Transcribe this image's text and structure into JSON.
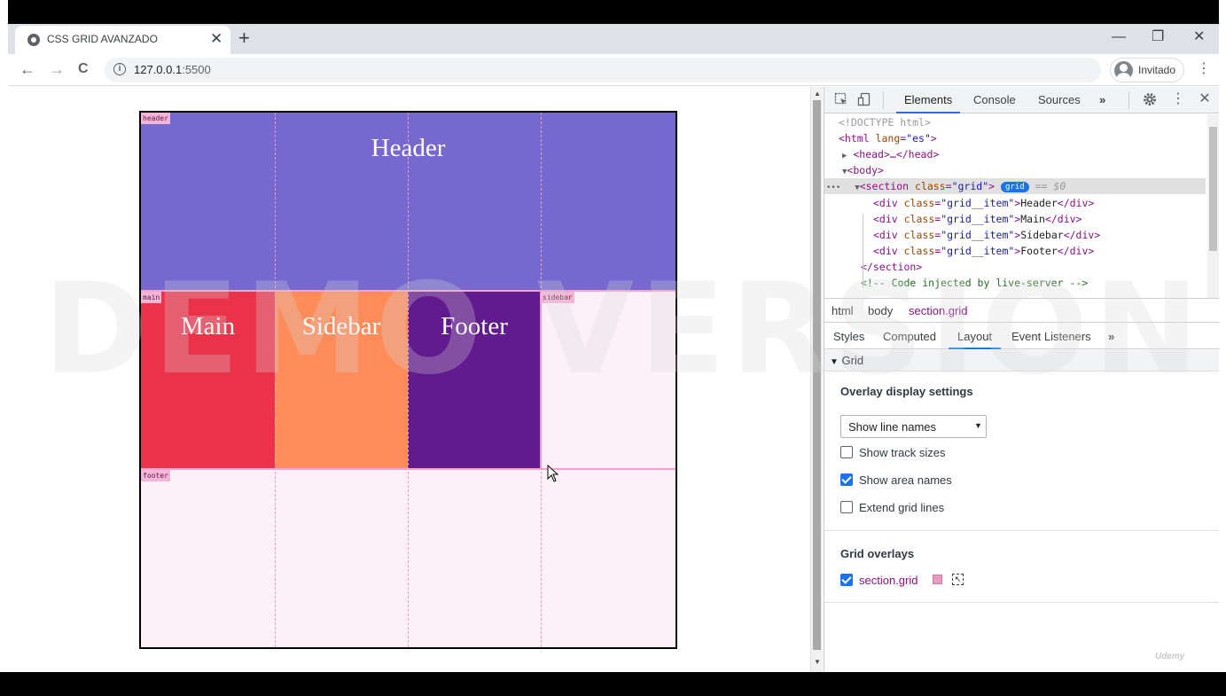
{
  "browser": {
    "tab_title": "CSS GRID AVANZADO",
    "tab_close": "✕",
    "new_tab": "+",
    "minimize": "—",
    "restore": "❐",
    "close": "✕",
    "back": "←",
    "forward": "→",
    "reload": "C",
    "url_host": "127.0.0.1",
    "url_port": ":5500",
    "profile_name": "Invitado",
    "menu": "⋮"
  },
  "page": {
    "cells": {
      "header": "Header",
      "main": "Main",
      "sidebar": "Sidebar",
      "footer": "Footer"
    },
    "area_names": {
      "header": "header",
      "main": "main",
      "sidebar": "sidebar",
      "footer": "footer"
    },
    "watermark": "DEMO VERSION"
  },
  "devtools": {
    "tabs": [
      "Elements",
      "Console",
      "Sources",
      "»"
    ],
    "dom": {
      "doctype": "<!DOCTYPE html>",
      "html_open_tag": "<html",
      "html_attr": "lang",
      "html_val": "\"es\"",
      "head": "<head>…</head>",
      "body": "<body>",
      "section_tag": "<section",
      "section_attr": "class",
      "section_val": "\"grid\"",
      "badge": "grid",
      "eq": "== $0",
      "div_tag": "<div",
      "div_attr": "class",
      "div_val": "\"grid__item\"",
      "div_close": "</div>",
      "items": [
        "Header",
        "Main",
        "Sidebar",
        "Footer"
      ],
      "section_close": "</section>",
      "comment": "<!-- Code injected by live-server -->",
      "dots": "•••"
    },
    "breadcrumbs": [
      "html",
      "body",
      "section.grid"
    ],
    "subtabs": [
      "Styles",
      "Computed",
      "Layout",
      "Event Listeners",
      "»"
    ],
    "layout": {
      "section_title": "Grid",
      "overlay_title": "Overlay display settings",
      "select_value": "Show line names",
      "checks": [
        {
          "label": "Show track sizes",
          "checked": false
        },
        {
          "label": "Show area names",
          "checked": true
        },
        {
          "label": "Extend grid lines",
          "checked": false
        }
      ],
      "grid_overlays_title": "Grid overlays",
      "overlay_item": "section.grid",
      "overlay_checked": true,
      "overlay_color": "#e99ac3"
    }
  },
  "watermark_brand": "Udemy",
  "colors": {
    "header": "#7668cf",
    "main": "#ea3349",
    "sidebar": "#fe8c5b",
    "footer": "#611b8e",
    "grid_bg": "#fdf1f7",
    "accent": "#1a73e8"
  }
}
